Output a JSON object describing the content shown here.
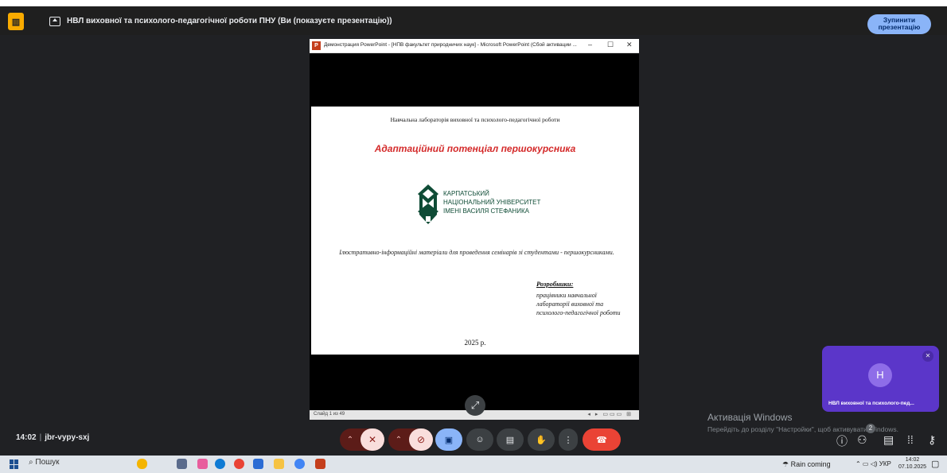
{
  "meet": {
    "presenting_title": "НВЛ виховної та психолого-педагогічної роботи ПНУ (Ви (показуєте презентацію))",
    "stop_button": "Зупинити презентацію",
    "time": "14:02",
    "meeting_code": "jbr-vypy-sxj",
    "participant": {
      "initial": "H",
      "name": "НВЛ виховної та психолого-пед..."
    },
    "notification_count": "2",
    "accent_color": "#8ab4f8",
    "end_call_color": "#ea4335"
  },
  "powerpoint": {
    "window_title": "Демонстрация PowerPoint - [НПВ факультет природничих наук] - Microsoft PowerPoint (Сбой активации ...",
    "status_left": "Слайд 1 из 49",
    "slide": {
      "lab": "Навчальна лабораторія виховної та психолого-педагогічної роботи",
      "title": "Адаптаційний потенціал першокурсника",
      "university_line1": "КАРПАТСЬКИЙ",
      "university_line2": "НАЦІОНАЛЬНИЙ УНІВЕРСИТЕТ",
      "university_line3": "ІМЕНІ ВАСИЛЯ СТЕФАНИКА",
      "subtitle": "Ілюстративно-інформаційні матеріали для проведення семінарів зі студентами - першокурсниками.",
      "developers_label": "Розробники:",
      "developers_text": "працівники навчальної лабораторії виховної та психолого-педагогічної роботи",
      "year": "2025 р."
    }
  },
  "windows_activation": {
    "line1": "Активація Windows",
    "line2": "Перейдіть до розділу \"Настройки\", щоб активувати Windows."
  },
  "taskbar": {
    "search": "Пошук",
    "weather": "Rain coming",
    "lang": "УКР",
    "clock_time": "14:02",
    "clock_date": "07.10.2025"
  }
}
